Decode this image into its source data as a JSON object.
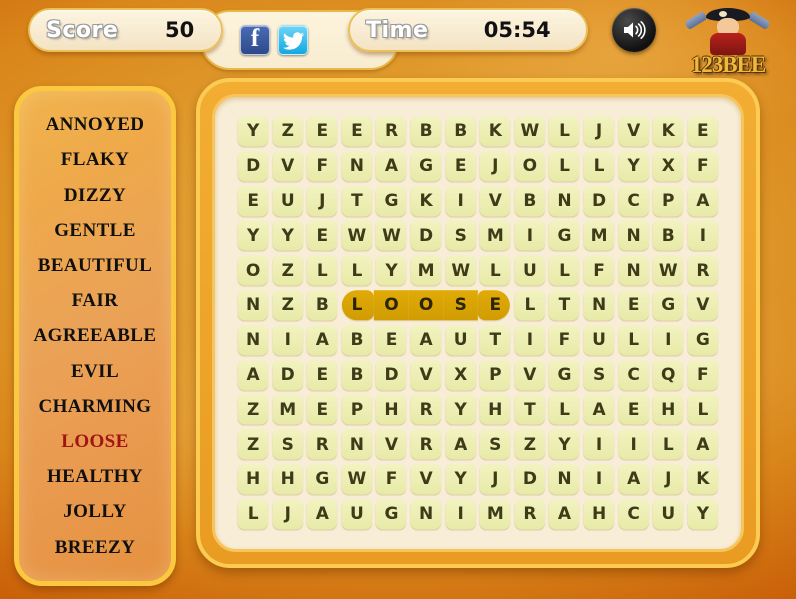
{
  "header": {
    "score_label": "Score",
    "score_value": "50",
    "time_label": "Time",
    "time_value": "05:54",
    "facebook_icon": "facebook-icon",
    "twitter_icon": "twitter-icon",
    "sound_icon": "sound-on-icon",
    "logo_text": "123BEE"
  },
  "wordlist": {
    "words": [
      {
        "text": "ANNOYED",
        "state": "pending"
      },
      {
        "text": "FLAKY",
        "state": "pending"
      },
      {
        "text": "DIZZY",
        "state": "pending"
      },
      {
        "text": "GENTLE",
        "state": "pending"
      },
      {
        "text": "BEAUTIFUL",
        "state": "pending"
      },
      {
        "text": "FAIR",
        "state": "pending"
      },
      {
        "text": "AGREEABLE",
        "state": "pending"
      },
      {
        "text": "EVIL",
        "state": "pending"
      },
      {
        "text": "CHARMING",
        "state": "pending"
      },
      {
        "text": "LOOSE",
        "state": "active"
      },
      {
        "text": "HEALTHY",
        "state": "pending"
      },
      {
        "text": "JOLLY",
        "state": "pending"
      },
      {
        "text": "BREEZY",
        "state": "pending"
      }
    ]
  },
  "board": {
    "rows": 12,
    "cols": 14,
    "grid": [
      [
        "Y",
        "Z",
        "E",
        "E",
        "R",
        "B",
        "B",
        "K",
        "W",
        "L",
        "J",
        "V",
        "K",
        "E"
      ],
      [
        "D",
        "V",
        "F",
        "N",
        "A",
        "G",
        "E",
        "J",
        "O",
        "L",
        "L",
        "Y",
        "X",
        "F"
      ],
      [
        "E",
        "U",
        "J",
        "T",
        "G",
        "K",
        "I",
        "V",
        "B",
        "N",
        "D",
        "C",
        "P",
        "A"
      ],
      [
        "Y",
        "Y",
        "E",
        "W",
        "W",
        "D",
        "S",
        "M",
        "I",
        "G",
        "M",
        "N",
        "B",
        "I"
      ],
      [
        "O",
        "Z",
        "L",
        "L",
        "Y",
        "M",
        "W",
        "L",
        "U",
        "L",
        "F",
        "N",
        "W",
        "R"
      ],
      [
        "N",
        "Z",
        "B",
        "L",
        "O",
        "O",
        "S",
        "E",
        "L",
        "T",
        "N",
        "E",
        "G",
        "V"
      ],
      [
        "N",
        "I",
        "A",
        "B",
        "E",
        "A",
        "U",
        "T",
        "I",
        "F",
        "U",
        "L",
        "I",
        "G"
      ],
      [
        "A",
        "D",
        "E",
        "B",
        "D",
        "V",
        "X",
        "P",
        "V",
        "G",
        "S",
        "C",
        "Q",
        "F"
      ],
      [
        "Z",
        "M",
        "E",
        "P",
        "H",
        "R",
        "Y",
        "H",
        "T",
        "L",
        "A",
        "E",
        "H",
        "L"
      ],
      [
        "Z",
        "S",
        "R",
        "N",
        "V",
        "R",
        "A",
        "S",
        "Z",
        "Y",
        "I",
        "I",
        "L",
        "A"
      ],
      [
        "H",
        "H",
        "G",
        "W",
        "F",
        "V",
        "Y",
        "J",
        "D",
        "N",
        "I",
        "A",
        "J",
        "K"
      ],
      [
        "L",
        "J",
        "A",
        "U",
        "G",
        "N",
        "I",
        "M",
        "R",
        "A",
        "H",
        "C",
        "U",
        "Y"
      ]
    ],
    "selection": {
      "word": "LOOSE",
      "row": 5,
      "col_start": 3,
      "col_end": 7
    },
    "colors": {
      "tile": "#EDEFB4",
      "tile_text": "#3C3C18",
      "selection": "#D4A004",
      "board_frame": "#F3AD33",
      "board_inner": "#F8EDD6"
    }
  }
}
